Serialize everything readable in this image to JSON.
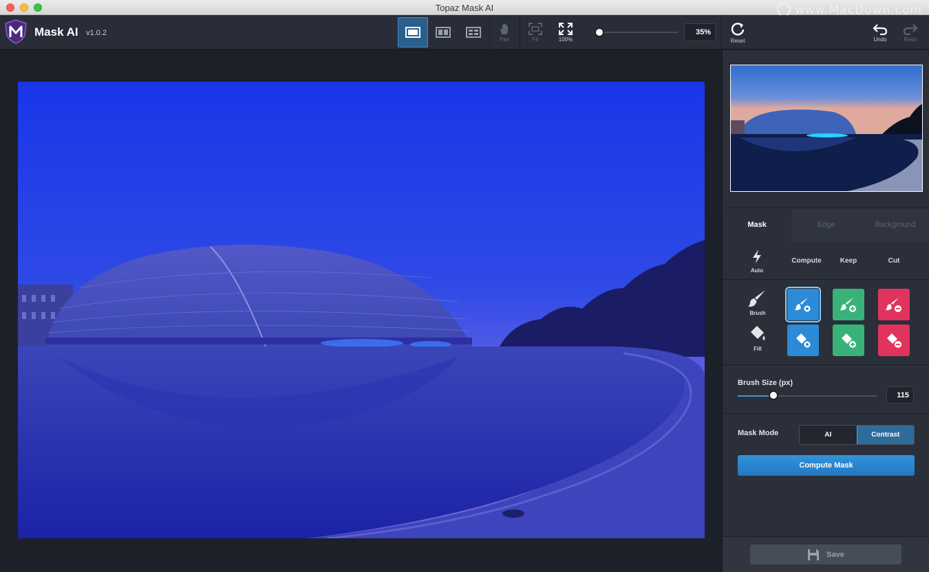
{
  "window": {
    "title": "Topaz Mask AI",
    "watermark": "www.MacDown.com"
  },
  "app": {
    "name": "Mask AI",
    "version": "v1.0.2"
  },
  "toolbar": {
    "view_buttons": [
      "single-view",
      "side-by-side-view",
      "split-view"
    ],
    "pan_label": "Pan",
    "fit_label": "Fit",
    "zoom100_label": "100%",
    "zoom_value": "35%",
    "zoom_level": 0.1,
    "reset_label": "Reset",
    "undo_label": "Undo",
    "redo_label": "Redo"
  },
  "panel": {
    "tabs": [
      {
        "label": "Mask",
        "active": true
      },
      {
        "label": "Edge",
        "active": false
      },
      {
        "label": "Background",
        "active": false
      }
    ],
    "modes": {
      "auto": "Auto",
      "compute": "Compute",
      "keep": "Keep",
      "cut": "Cut"
    },
    "tools": {
      "brush": "Brush",
      "fill": "Fill"
    },
    "brush_size": {
      "label": "Brush Size (px)",
      "value": "115",
      "level": 0.24
    },
    "mask_mode": {
      "label": "Mask Mode",
      "options": [
        "AI",
        "Contrast"
      ],
      "selected": "Contrast"
    },
    "compute_button": "Compute Mask",
    "save_button": "Save"
  },
  "colors": {
    "accent": "#2b8bd6",
    "compute": "#2b8bd6",
    "keep": "#39b27a",
    "cut": "#e0345e",
    "panel_bg": "#2a2f39",
    "toolbar_bg": "#282d38"
  }
}
